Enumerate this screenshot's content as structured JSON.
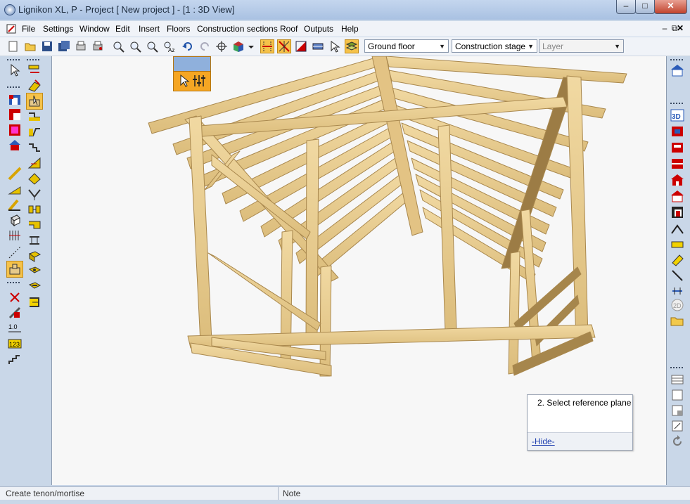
{
  "window": {
    "title": "Lignikon XL, P - Project [ New project ]  - [1 : 3D View]",
    "controls": {
      "minimize": "–",
      "maximize": "□",
      "close": "✕"
    }
  },
  "menu": {
    "items": [
      "File",
      "Settings",
      "Window",
      "Edit",
      "Insert",
      "Floors",
      "Construction sections",
      "Roof",
      "Outputs",
      "Help"
    ],
    "mdi_minimize": "–",
    "mdi_restore": "⧉",
    "mdi_close": "✕"
  },
  "toolbar": {
    "floor_select": "Ground floor",
    "stage_select": "Construction stage",
    "layer_select": "Layer",
    "icons": [
      "new-file-icon",
      "open-folder-icon",
      "save-icon",
      "save-all-icon",
      "print-preview-icon",
      "print-icon",
      "zoom-in-icon",
      "zoom-out-icon",
      "zoom-window-icon",
      "zoom-label-icon",
      "undo-icon",
      "redo-icon",
      "crosshair-icon",
      "view-cube-icon",
      "snap-grid-icon",
      "snap-star-icon",
      "section-icon",
      "hatch-icon",
      "pointer-icon",
      "layers-icon"
    ]
  },
  "hint_box": {
    "text": "2. Select reference plane",
    "hide_link": "-Hide-"
  },
  "statusbar": {
    "left": "Create tenon/mortise",
    "note": "Note"
  },
  "colors": {
    "timber": "#e6c98b",
    "timber_dark": "#b8955a",
    "selection": "#f5c24a",
    "ui_bg": "#c9d7e8"
  }
}
